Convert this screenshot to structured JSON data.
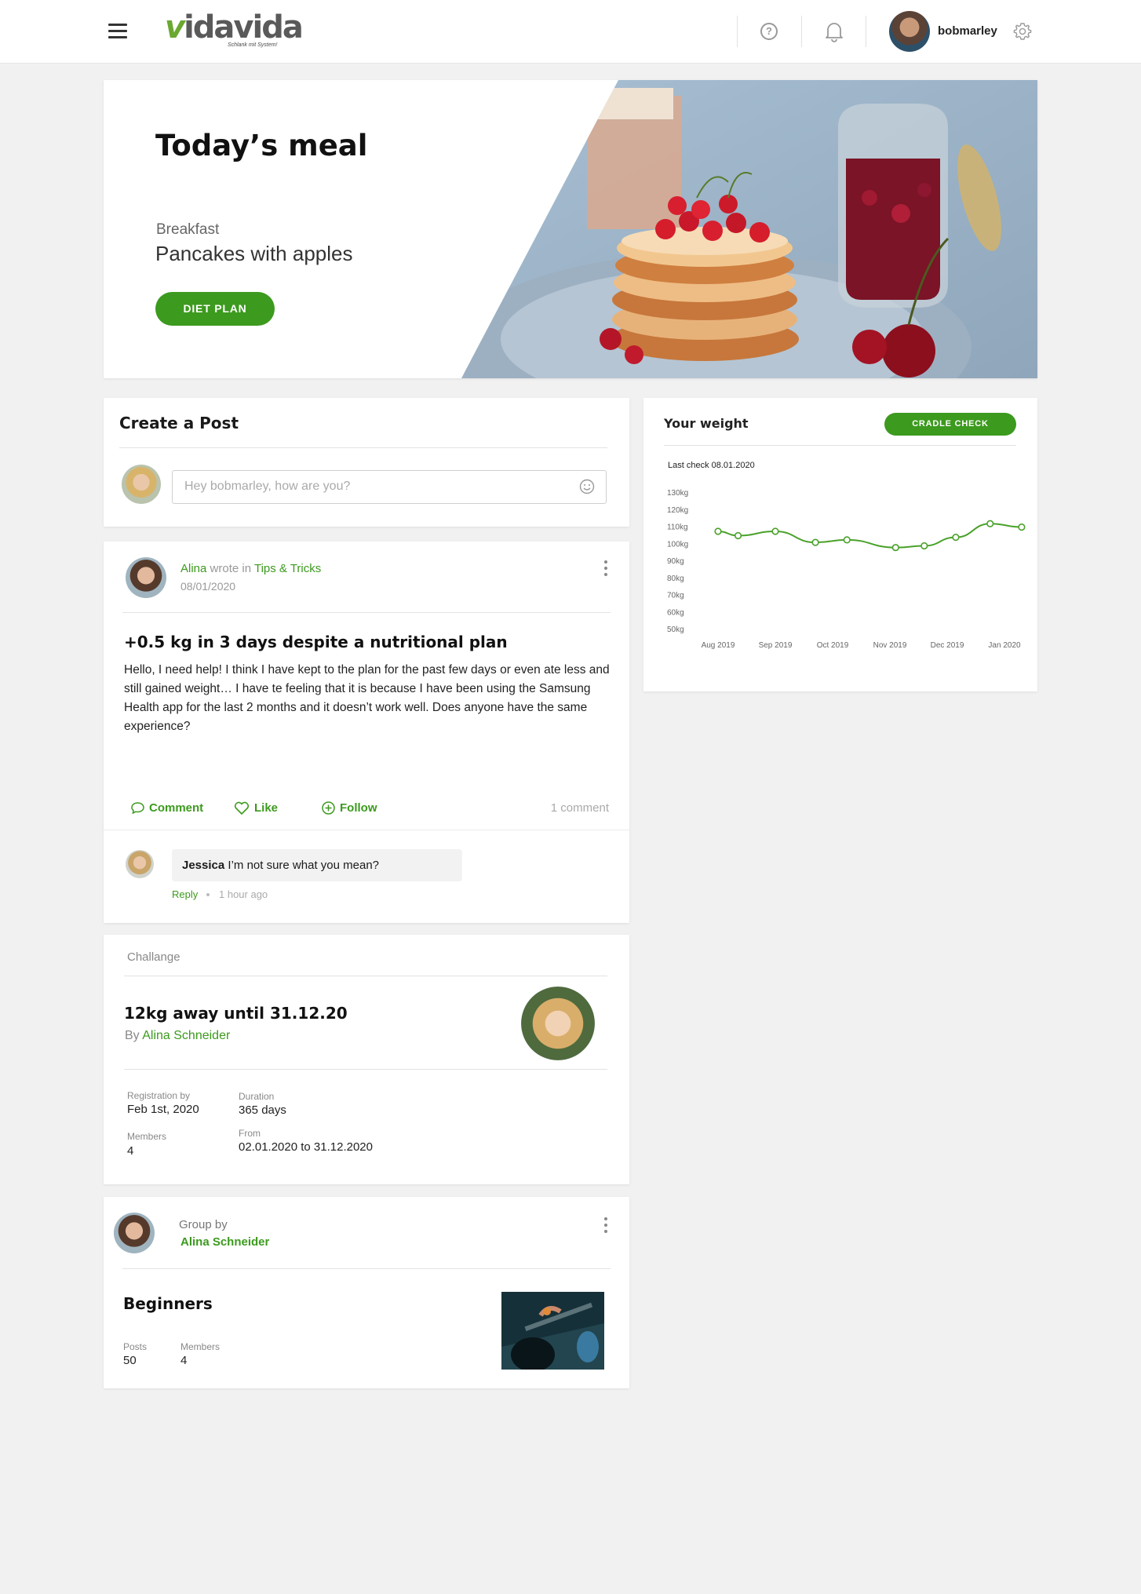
{
  "header": {
    "logo_text": "vidavida",
    "logo_tagline": "Schlank mit System!",
    "help_glyph": "?",
    "username": "bobmarley",
    "icons": [
      "menu-icon",
      "help-icon",
      "bell-icon",
      "gear-icon"
    ]
  },
  "hero": {
    "title": "Today’s meal",
    "meal_type": "Breakfast",
    "meal_name": "Pancakes with apples",
    "button": "DIET PLAN"
  },
  "create_post": {
    "title": "Create a Post",
    "placeholder": "Hey bobmarley, how are you?"
  },
  "post": {
    "author": "Alina",
    "wrote_in": "wrote in",
    "category": "Tips & Tricks",
    "date": "08/01/2020",
    "title": "+0.5 kg in 3 days despite a nutritional plan",
    "body": "Hello, I need help! I think I have kept to the plan for the past few days or even ate less and still gained weight… I have te feeling that it is because I have been using the Samsung Health app for the last 2 months and it doesn’t work well. Does anyone have the same experience?",
    "actions": {
      "comment": "Comment",
      "like": "Like",
      "follow": "Follow"
    },
    "comment_count": "1 comment",
    "comment": {
      "author": "Jessica",
      "text": "I’m not sure what you mean?",
      "reply": "Reply",
      "time": "1 hour ago"
    }
  },
  "challenge": {
    "label": "Challange",
    "title": "12kg away until 31.12.20",
    "by_prefix": "By",
    "by_name": "Alina Schneider",
    "registration_label": "Registration by",
    "registration_value": "Feb 1st, 2020",
    "duration_label": "Duration",
    "duration_value": "365 days",
    "members_label": "Members",
    "members_value": "4",
    "from_label": "From",
    "from_value": "02.01.2020 to 31.12.2020"
  },
  "group": {
    "by_label": "Group by",
    "owner": "Alina Schneider",
    "name": "Beginners",
    "posts_label": "Posts",
    "posts_value": "50",
    "members_label": "Members",
    "members_value": "4"
  },
  "weight": {
    "title": "Your weight",
    "button": "CRADLE CHECK",
    "last_check": "Last check 08.01.2020"
  },
  "colors": {
    "accent": "#3c9a1e",
    "line": "#4aa12a",
    "background": "#f1f1f1"
  },
  "chart_data": {
    "type": "line",
    "title": "",
    "xlabel": "",
    "ylabel": "",
    "y_ticks": [
      "130kg",
      "120kg",
      "110kg",
      "100kg",
      "90kg",
      "80kg",
      "70kg",
      "60kg",
      "50kg"
    ],
    "x_ticks": [
      "Aug 2019",
      "Sep 2019",
      "Oct 2019",
      "Nov 2019",
      "Dec 2019",
      "Jan 2020"
    ],
    "ylim": [
      50,
      130
    ],
    "grid": false,
    "series": [
      {
        "x": [
          0,
          0.35,
          1.0,
          1.7,
          2.25,
          3.1,
          3.6,
          4.15,
          4.75,
          5.3
        ],
        "values": [
          107,
          104.5,
          107,
          100.5,
          102,
          97.5,
          98.5,
          103.5,
          111.5,
          109.5
        ]
      }
    ]
  }
}
